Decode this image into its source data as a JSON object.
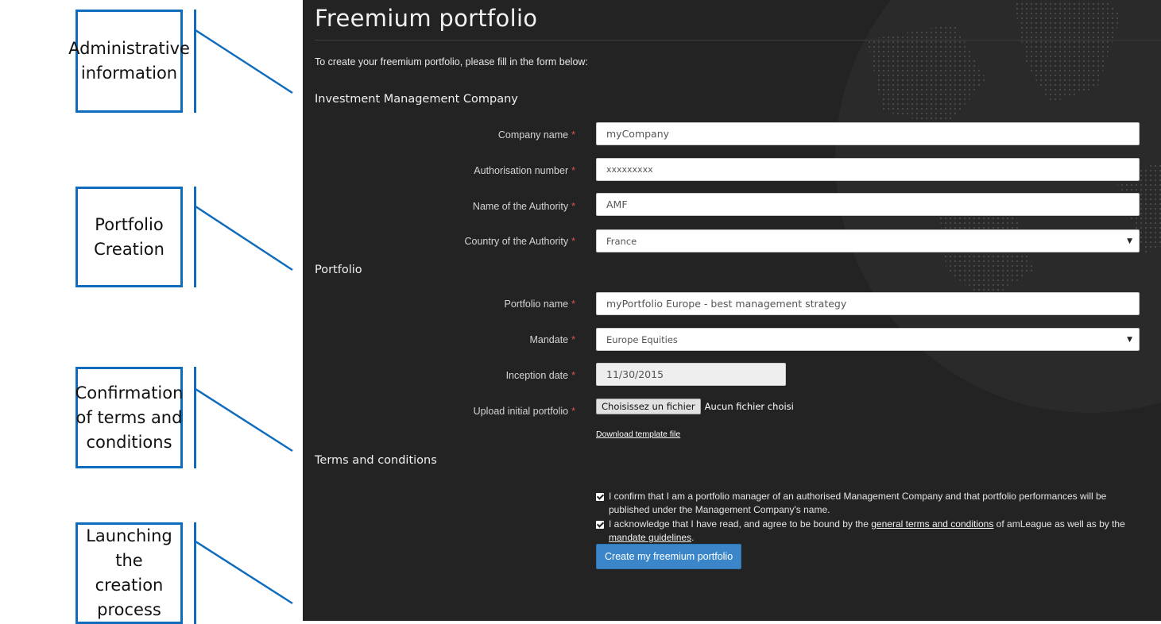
{
  "callouts": [
    {
      "text": "Administrative\ninformation"
    },
    {
      "text": "Portfolio\nCreation"
    },
    {
      "text": "Confirmation\nof terms and\nconditions"
    },
    {
      "text": "Launching the\ncreation\nprocess"
    }
  ],
  "page": {
    "title": "Freemium portfolio",
    "intro": "To create your freemium portfolio, please fill in the form below:"
  },
  "sections": {
    "company": "Investment Management Company",
    "portfolio": "Portfolio",
    "terms": "Terms and conditions"
  },
  "required_marker": "*",
  "company_form": {
    "company_name": {
      "label": "Company name",
      "value": "myCompany"
    },
    "authorisation_number": {
      "label": "Authorisation number",
      "value": "xxxxxxxxx"
    },
    "authority_name": {
      "label": "Name of the Authority",
      "value": "AMF"
    },
    "authority_country": {
      "label": "Country of the Authority",
      "value": "France"
    }
  },
  "portfolio_form": {
    "portfolio_name": {
      "label": "Portfolio name",
      "value": "myPortfolio Europe - best management strategy"
    },
    "mandate": {
      "label": "Mandate",
      "value": "Europe Equities"
    },
    "inception_date": {
      "label": "Inception date",
      "value": "11/30/2015"
    },
    "upload": {
      "label": "Upload initial portfolio",
      "button": "Choisissez un fichier",
      "status": "Aucun fichier choisi",
      "template_link": "Download template file"
    }
  },
  "terms": {
    "confirm_manager": "I confirm that I am a portfolio manager of an authorised Management Company and that portfolio performances will be published under the Management Company's name.",
    "acknowledge_prefix": "I acknowledge that I have read, and agree to be bound by the ",
    "general_terms_link": "general terms and conditions",
    "acknowledge_middle": " of amLeague as well as by the ",
    "mandate_guidelines_link": "mandate guidelines",
    "acknowledge_suffix": ".",
    "confirm_checked": true,
    "acknowledge_checked": true
  },
  "submit_label": "Create my freemium portfolio",
  "colors": {
    "callout_border": "#0f6cbd",
    "panel_bg": "#232323",
    "required": "#d9534f",
    "primary_button": "#3a86c8"
  }
}
